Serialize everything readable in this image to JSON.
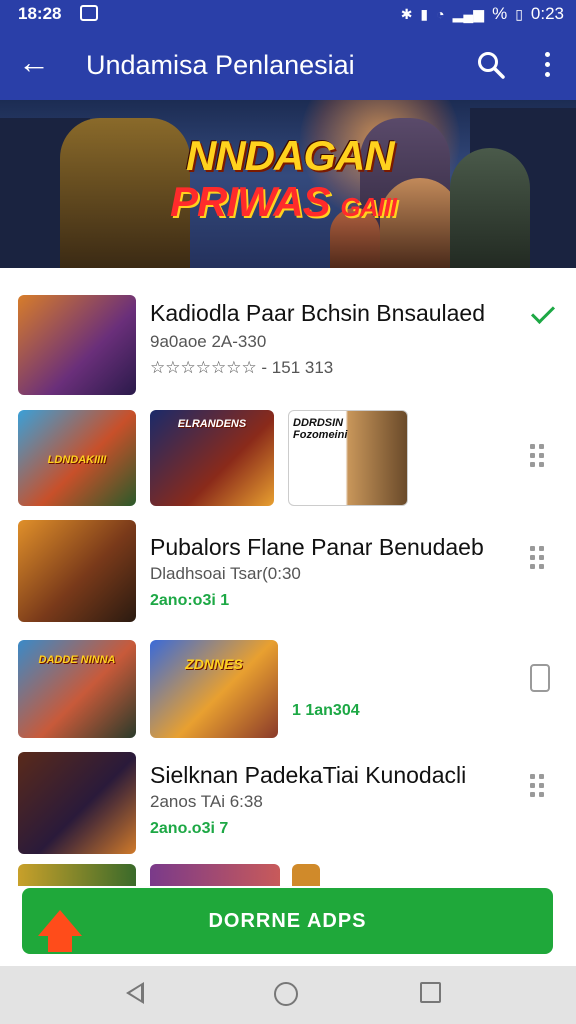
{
  "status_bar": {
    "time": "18:28",
    "right_text": "% ",
    "clock_right": "0:23"
  },
  "app_bar": {
    "title": "Undamisa Penlanesiai",
    "back_icon": "arrow-left-icon",
    "search_icon": "search-icon",
    "more_icon": "more-vert-icon"
  },
  "banner": {
    "line1": "NNDAGAN",
    "line2": "PRIWAS",
    "line2_small": "GAIII"
  },
  "items": [
    {
      "title": "Kadiodla Paar Bchsin Bnsaulaed",
      "sub": "9a0aoe 2A-330",
      "ratings": "☆☆☆☆☆☆☆ - 151 313",
      "status_icon": "check-icon"
    },
    {
      "thumb_caps": [
        "LDNDAKIIII",
        "ELRANDENS",
        "DDRDSIN Fozomeini"
      ],
      "status_icon": "grid-dots-icon"
    },
    {
      "title": "Pubalors Flane Panar Benudaeb",
      "sub": "Dladhsoai Tsar(0:30",
      "green": "2ano:o3i 1",
      "status_icon": "grid-dots-icon"
    },
    {
      "thumb_caps": [
        "DADDE NINNA",
        "ZDNNES"
      ],
      "green": "1 1an304",
      "status_icon": "device-icon"
    },
    {
      "title": "Sielknan PadekaTiai Kunodacli",
      "sub": "2anos TAi 6:38",
      "green": "2ano.o3i 7",
      "status_icon": "grid-dots-icon"
    }
  ],
  "download_button": {
    "label": "DORRNE ADPS"
  },
  "nav_bar": {
    "back": "nav-back-icon",
    "home": "nav-home-icon",
    "recents": "nav-recents-icon"
  }
}
